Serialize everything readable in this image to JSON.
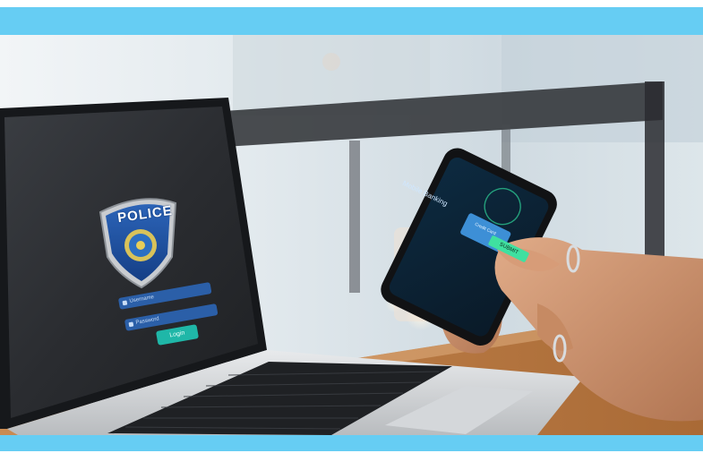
{
  "image": {
    "description_colors": {
      "band": "#66cdf3",
      "login_button": "#1fb7a8",
      "input_fields": "#2b5fa8"
    }
  },
  "laptop": {
    "badge_title": "POLICE",
    "login": {
      "username_placeholder": "Username",
      "password_placeholder": "Password",
      "button_label": "Login"
    }
  },
  "phone": {
    "screen_title": "Mobile Banking",
    "card_label": "Credit Card",
    "submit_label": "SUBMIT"
  }
}
